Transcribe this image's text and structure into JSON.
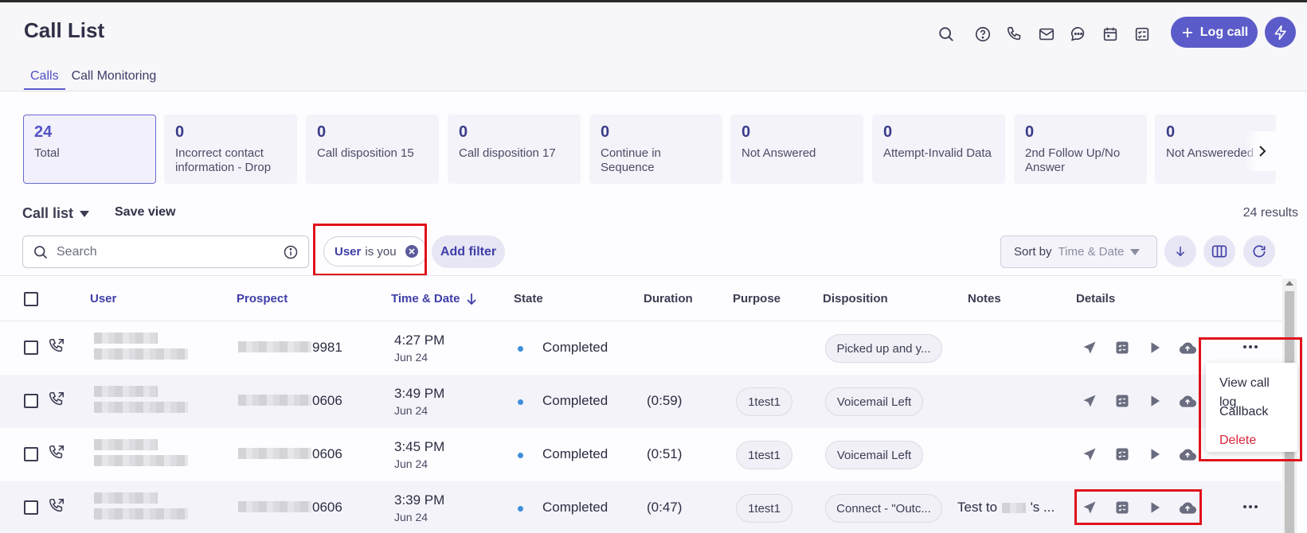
{
  "header": {
    "title": "Call List",
    "log_call_label": "Log call"
  },
  "tabs": [
    {
      "label": "Calls",
      "active": true
    },
    {
      "label": "Call Monitoring",
      "active": false
    }
  ],
  "stats": [
    {
      "count": "24",
      "label": "Total",
      "active": true
    },
    {
      "count": "0",
      "label": "Incorrect contact information - Drop"
    },
    {
      "count": "0",
      "label": "Call disposition 15"
    },
    {
      "count": "0",
      "label": "Call disposition 17"
    },
    {
      "count": "0",
      "label": "Continue in Sequence"
    },
    {
      "count": "0",
      "label": "Not Answered"
    },
    {
      "count": "0",
      "label": "Attempt-Invalid Data"
    },
    {
      "count": "0",
      "label": "2nd Follow Up/No Answer"
    },
    {
      "count": "0",
      "label": "Not Answereded"
    }
  ],
  "list": {
    "title": "Call list",
    "save_view": "Save view",
    "results": "24 results"
  },
  "search": {
    "placeholder": "Search"
  },
  "filter_chip": {
    "field": "User",
    "operator": "is you"
  },
  "add_filter": "Add filter",
  "sort": {
    "label": "Sort by",
    "value": "Time & Date"
  },
  "columns": {
    "user": "User",
    "prospect": "Prospect",
    "time_date": "Time & Date",
    "state": "State",
    "duration": "Duration",
    "purpose": "Purpose",
    "disposition": "Disposition",
    "notes": "Notes",
    "details": "Details"
  },
  "rows": [
    {
      "prospect_suffix": "9981",
      "time": "4:27 PM",
      "date": "Jun 24",
      "state": "Completed",
      "duration": "",
      "purpose": "",
      "disposition": "Picked up and y...",
      "notes": ""
    },
    {
      "prospect_suffix": "0606",
      "time": "3:49 PM",
      "date": "Jun 24",
      "state": "Completed",
      "duration": "(0:59)",
      "purpose": "1test1",
      "disposition": "Voicemail Left",
      "notes": ""
    },
    {
      "prospect_suffix": "0606",
      "time": "3:45 PM",
      "date": "Jun 24",
      "state": "Completed",
      "duration": "(0:51)",
      "purpose": "1test1",
      "disposition": "Voicemail Left",
      "notes": ""
    },
    {
      "prospect_suffix": "0606",
      "time": "3:39 PM",
      "date": "Jun 24",
      "state": "Completed",
      "duration": "(0:47)",
      "purpose": "1test1",
      "disposition": "Connect - \"Outc...",
      "notes_prefix": "Test to",
      "notes_suffix": "'s ..."
    }
  ],
  "context_menu": {
    "items": [
      {
        "label": "View call log"
      },
      {
        "label": "Callback"
      },
      {
        "label": "Delete"
      }
    ]
  },
  "colors": {
    "accent": "#5b5bc9",
    "highlight": "#e0111b",
    "danger": "#d9253b",
    "state_dot": "#3f8fd9"
  }
}
